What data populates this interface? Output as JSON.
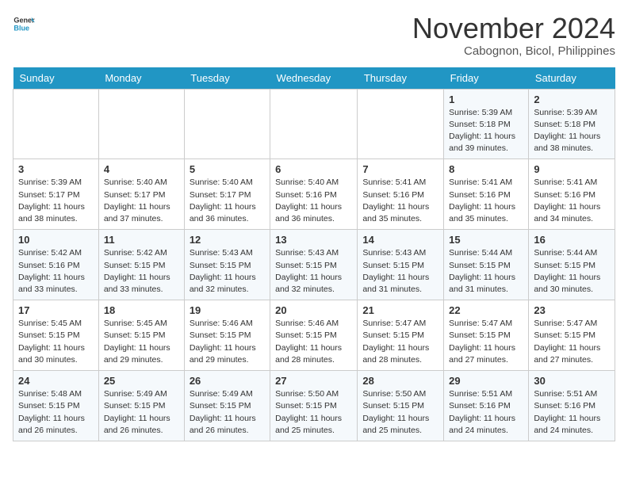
{
  "header": {
    "logo_line1": "General",
    "logo_line2": "Blue",
    "month": "November 2024",
    "location": "Cabognon, Bicol, Philippines"
  },
  "days_of_week": [
    "Sunday",
    "Monday",
    "Tuesday",
    "Wednesday",
    "Thursday",
    "Friday",
    "Saturday"
  ],
  "weeks": [
    [
      {
        "day": "",
        "info": ""
      },
      {
        "day": "",
        "info": ""
      },
      {
        "day": "",
        "info": ""
      },
      {
        "day": "",
        "info": ""
      },
      {
        "day": "",
        "info": ""
      },
      {
        "day": "1",
        "info": "Sunrise: 5:39 AM\nSunset: 5:18 PM\nDaylight: 11 hours\nand 39 minutes."
      },
      {
        "day": "2",
        "info": "Sunrise: 5:39 AM\nSunset: 5:18 PM\nDaylight: 11 hours\nand 38 minutes."
      }
    ],
    [
      {
        "day": "3",
        "info": "Sunrise: 5:39 AM\nSunset: 5:17 PM\nDaylight: 11 hours\nand 38 minutes."
      },
      {
        "day": "4",
        "info": "Sunrise: 5:40 AM\nSunset: 5:17 PM\nDaylight: 11 hours\nand 37 minutes."
      },
      {
        "day": "5",
        "info": "Sunrise: 5:40 AM\nSunset: 5:17 PM\nDaylight: 11 hours\nand 36 minutes."
      },
      {
        "day": "6",
        "info": "Sunrise: 5:40 AM\nSunset: 5:16 PM\nDaylight: 11 hours\nand 36 minutes."
      },
      {
        "day": "7",
        "info": "Sunrise: 5:41 AM\nSunset: 5:16 PM\nDaylight: 11 hours\nand 35 minutes."
      },
      {
        "day": "8",
        "info": "Sunrise: 5:41 AM\nSunset: 5:16 PM\nDaylight: 11 hours\nand 35 minutes."
      },
      {
        "day": "9",
        "info": "Sunrise: 5:41 AM\nSunset: 5:16 PM\nDaylight: 11 hours\nand 34 minutes."
      }
    ],
    [
      {
        "day": "10",
        "info": "Sunrise: 5:42 AM\nSunset: 5:16 PM\nDaylight: 11 hours\nand 33 minutes."
      },
      {
        "day": "11",
        "info": "Sunrise: 5:42 AM\nSunset: 5:15 PM\nDaylight: 11 hours\nand 33 minutes."
      },
      {
        "day": "12",
        "info": "Sunrise: 5:43 AM\nSunset: 5:15 PM\nDaylight: 11 hours\nand 32 minutes."
      },
      {
        "day": "13",
        "info": "Sunrise: 5:43 AM\nSunset: 5:15 PM\nDaylight: 11 hours\nand 32 minutes."
      },
      {
        "day": "14",
        "info": "Sunrise: 5:43 AM\nSunset: 5:15 PM\nDaylight: 11 hours\nand 31 minutes."
      },
      {
        "day": "15",
        "info": "Sunrise: 5:44 AM\nSunset: 5:15 PM\nDaylight: 11 hours\nand 31 minutes."
      },
      {
        "day": "16",
        "info": "Sunrise: 5:44 AM\nSunset: 5:15 PM\nDaylight: 11 hours\nand 30 minutes."
      }
    ],
    [
      {
        "day": "17",
        "info": "Sunrise: 5:45 AM\nSunset: 5:15 PM\nDaylight: 11 hours\nand 30 minutes."
      },
      {
        "day": "18",
        "info": "Sunrise: 5:45 AM\nSunset: 5:15 PM\nDaylight: 11 hours\nand 29 minutes."
      },
      {
        "day": "19",
        "info": "Sunrise: 5:46 AM\nSunset: 5:15 PM\nDaylight: 11 hours\nand 29 minutes."
      },
      {
        "day": "20",
        "info": "Sunrise: 5:46 AM\nSunset: 5:15 PM\nDaylight: 11 hours\nand 28 minutes."
      },
      {
        "day": "21",
        "info": "Sunrise: 5:47 AM\nSunset: 5:15 PM\nDaylight: 11 hours\nand 28 minutes."
      },
      {
        "day": "22",
        "info": "Sunrise: 5:47 AM\nSunset: 5:15 PM\nDaylight: 11 hours\nand 27 minutes."
      },
      {
        "day": "23",
        "info": "Sunrise: 5:47 AM\nSunset: 5:15 PM\nDaylight: 11 hours\nand 27 minutes."
      }
    ],
    [
      {
        "day": "24",
        "info": "Sunrise: 5:48 AM\nSunset: 5:15 PM\nDaylight: 11 hours\nand 26 minutes."
      },
      {
        "day": "25",
        "info": "Sunrise: 5:49 AM\nSunset: 5:15 PM\nDaylight: 11 hours\nand 26 minutes."
      },
      {
        "day": "26",
        "info": "Sunrise: 5:49 AM\nSunset: 5:15 PM\nDaylight: 11 hours\nand 26 minutes."
      },
      {
        "day": "27",
        "info": "Sunrise: 5:50 AM\nSunset: 5:15 PM\nDaylight: 11 hours\nand 25 minutes."
      },
      {
        "day": "28",
        "info": "Sunrise: 5:50 AM\nSunset: 5:15 PM\nDaylight: 11 hours\nand 25 minutes."
      },
      {
        "day": "29",
        "info": "Sunrise: 5:51 AM\nSunset: 5:16 PM\nDaylight: 11 hours\nand 24 minutes."
      },
      {
        "day": "30",
        "info": "Sunrise: 5:51 AM\nSunset: 5:16 PM\nDaylight: 11 hours\nand 24 minutes."
      }
    ]
  ]
}
